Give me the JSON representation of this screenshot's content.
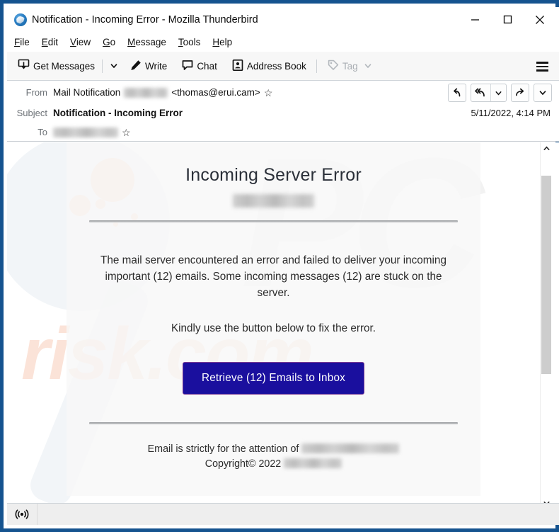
{
  "window": {
    "title": "Notification - Incoming Error - Mozilla Thunderbird",
    "app_icon": "thunderbird-logo-icon",
    "minimize_label": "–",
    "maximize_label": "□",
    "close_label": "✕"
  },
  "menu_bar": {
    "items": [
      {
        "label": "File",
        "accesskey": "F"
      },
      {
        "label": "Edit",
        "accesskey": "E"
      },
      {
        "label": "View",
        "accesskey": "V"
      },
      {
        "label": "Go",
        "accesskey": "G"
      },
      {
        "label": "Message",
        "accesskey": "M"
      },
      {
        "label": "Tools",
        "accesskey": "T"
      },
      {
        "label": "Help",
        "accesskey": "H"
      }
    ]
  },
  "toolbar": {
    "get_messages_label": "Get Messages",
    "get_messages_icon": "inbox-download-icon",
    "get_messages_caret_icon": "chevron-down-icon",
    "write_label": "Write",
    "write_icon": "pencil-icon",
    "chat_label": "Chat",
    "chat_icon": "speech-bubble-icon",
    "address_book_label": "Address Book",
    "address_book_icon": "contact-card-icon",
    "tag_label": "Tag",
    "tag_icon": "tag-icon",
    "tag_caret_icon": "chevron-down-icon",
    "tag_disabled": true,
    "app_menu_icon": "hamburger-menu-icon"
  },
  "message_header": {
    "from_label": "From",
    "from_sender": "Mail Notification",
    "from_redacted": "███████",
    "from_address": "<thomas@erui.cam>",
    "from_star_icon": "star-outline-icon",
    "subject_label": "Subject",
    "subject_value": "Notification - Incoming Error",
    "to_label": "To",
    "to_redacted": "█████████████",
    "to_star_icon": "star-outline-icon",
    "date": "5/11/2022, 4:14 PM",
    "actions": {
      "reply_icon": "reply-arrow-icon",
      "reply_all_icon": "reply-all-arrow-icon",
      "reply_all_caret_icon": "chevron-down-icon",
      "forward_icon": "forward-arrow-icon",
      "more_caret_icon": "chevron-down-icon"
    }
  },
  "email": {
    "title": "Incoming Server Error",
    "domain_redacted": "████████",
    "paragraph1": "The mail server encountered an error and failed to deliver your incoming important (12) emails. Some incoming messages (12) are stuck on the server.",
    "paragraph2": "Kindly use the button below to fix the error.",
    "cta_label": "Retrieve (12) Emails to Inbox",
    "footer_line1_prefix": "Email is strictly for the attention of ",
    "footer_line1_redacted": "██████████████",
    "footer_line2_prefix": "Copyright© 2022 ",
    "footer_line2_redacted": "████████",
    "watermark_text": "risk.com",
    "watermark_mark": "PC"
  },
  "scrollbar": {
    "up_icon": "chevron-up-icon",
    "down_icon": "chevron-down-icon",
    "thumb": "scrollbar-thumb"
  },
  "status_bar": {
    "connection_icon": "broadcast-signal-icon",
    "status_text": ""
  },
  "colors": {
    "window_border": "#15538f",
    "toolbar_bg": "#f7f7f7",
    "cta_bg": "#1a0f9e",
    "cta_border": "#7a3b94",
    "card_bg": "#f8f8f8",
    "status_bar_bg": "#eeeeee"
  }
}
